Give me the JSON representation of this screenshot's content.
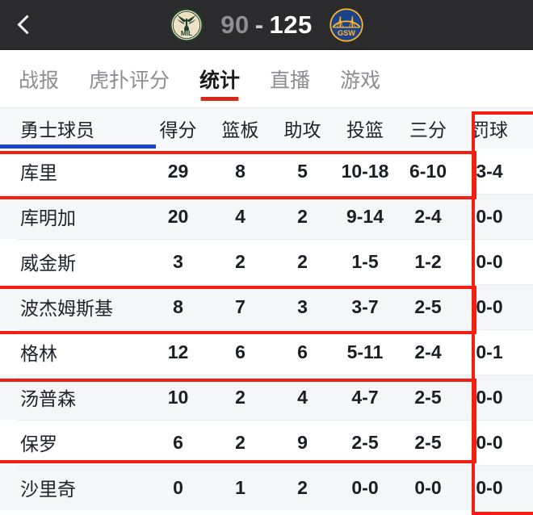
{
  "topbar": {
    "back_icon": "chevron-left-icon",
    "away_team": {
      "abbr": "MIL",
      "logo_icon": "bucks-logo-icon"
    },
    "home_team": {
      "abbr": "GSW",
      "logo_icon": "warriors-logo-icon"
    },
    "score": {
      "away": "90",
      "separator": "-",
      "home": "125"
    },
    "accent_bg": "#2b2b2d"
  },
  "tabs": {
    "active_index": 2,
    "accent_color": "#d92b1c",
    "items": [
      {
        "label": "战报"
      },
      {
        "label": "虎扑评分"
      },
      {
        "label": "统计"
      },
      {
        "label": "直播"
      },
      {
        "label": "游戏"
      }
    ]
  },
  "table": {
    "underline_color": "#1a46c4",
    "highlight_color": "#f41f10",
    "headers": {
      "name": "勇士球员",
      "points": "得分",
      "rebounds": "篮板",
      "assists": "助攻",
      "fg": "投篮",
      "three": "三分",
      "ft": "罚球"
    },
    "rows": [
      {
        "name": "库里",
        "points": "29",
        "rebounds": "8",
        "assists": "5",
        "fg": "10-18",
        "three": "6-10",
        "ft": "3-4",
        "highlighted": true
      },
      {
        "name": "库明加",
        "points": "20",
        "rebounds": "4",
        "assists": "2",
        "fg": "9-14",
        "three": "2-4",
        "ft": "0-0",
        "highlighted": false
      },
      {
        "name": "威金斯",
        "points": "3",
        "rebounds": "2",
        "assists": "2",
        "fg": "1-5",
        "three": "1-2",
        "ft": "0-0",
        "highlighted": false
      },
      {
        "name": "波杰姆斯基",
        "points": "8",
        "rebounds": "7",
        "assists": "3",
        "fg": "3-7",
        "three": "2-5",
        "ft": "0-0",
        "highlighted": true
      },
      {
        "name": "格林",
        "points": "12",
        "rebounds": "6",
        "assists": "6",
        "fg": "5-11",
        "three": "2-4",
        "ft": "0-1",
        "highlighted": false
      },
      {
        "name": "汤普森",
        "points": "10",
        "rebounds": "2",
        "assists": "4",
        "fg": "4-7",
        "three": "2-5",
        "ft": "0-0",
        "highlighted": true
      },
      {
        "name": "保罗",
        "points": "6",
        "rebounds": "2",
        "assists": "9",
        "fg": "2-5",
        "three": "2-5",
        "ft": "0-0",
        "highlighted": true
      },
      {
        "name": "沙里奇",
        "points": "0",
        "rebounds": "1",
        "assists": "2",
        "fg": "0-0",
        "three": "0-0",
        "ft": "0-0",
        "highlighted": false
      }
    ]
  }
}
